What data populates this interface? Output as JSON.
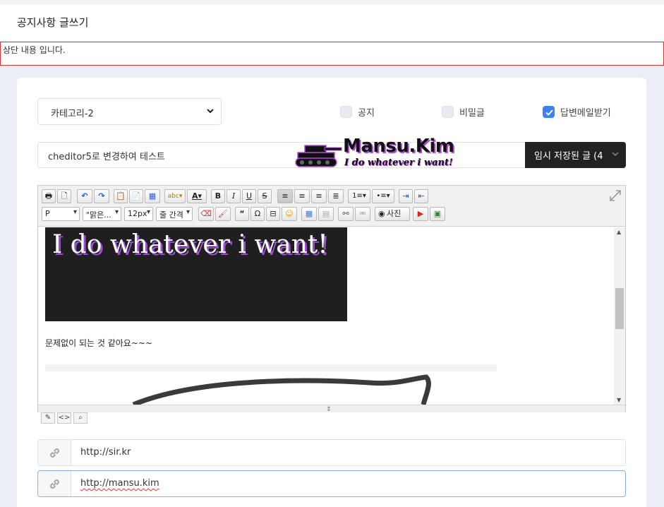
{
  "header": {
    "title": "공지사항 글쓰기"
  },
  "notice": {
    "text": "상단 내용 입니다."
  },
  "form": {
    "category": {
      "selected": "카테고리-2"
    },
    "options": [
      {
        "label": "공지",
        "checked": false
      },
      {
        "label": "비밀글",
        "checked": false
      },
      {
        "label": "답변메일받기",
        "checked": true
      }
    ],
    "subject": {
      "value": "cheditor5로 변경하여 테스트"
    },
    "autosave_label": "임시 저장된 글 (4",
    "logo": {
      "title": "Mansu.Kim",
      "tagline": "I do whatever i want!"
    }
  },
  "editor": {
    "toolbar": {
      "format": "P",
      "font": "\"맑은...",
      "size": "12px",
      "line_height": "줄 간격",
      "photo_label": "사진"
    },
    "content": {
      "banner_text": "I do whatever i want!",
      "paragraph": "문제없이 되는 것 같아요~~~"
    },
    "modes": [
      "edit",
      "source",
      "preview"
    ]
  },
  "links": [
    {
      "value": "http://sir.kr",
      "focused": false
    },
    {
      "value": "http://mansu.kim",
      "focused": true
    }
  ],
  "colors": {
    "accent": "#3b82f6",
    "dark_button": "#222222",
    "notice_border": "#dd3333",
    "banner_shadow": "#9d4fd1"
  }
}
